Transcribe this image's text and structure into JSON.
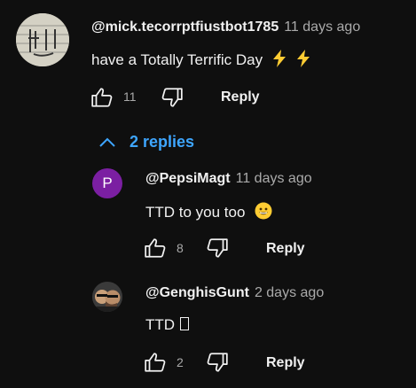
{
  "comment": {
    "author": "@mick.tecorrptfiustbot1785",
    "time": "11 days ago",
    "text": "have a Totally Terrific Day",
    "like_count": "11",
    "reply_label": "Reply"
  },
  "replies_toggle": {
    "label": "2 replies",
    "icon": "chevron-up-icon",
    "color": "#3ea6ff"
  },
  "replies": [
    {
      "author": "@PepsiMagt",
      "time": "11 days ago",
      "text": "TTD to you too",
      "avatar_letter": "P",
      "avatar_color": "#7b1fa2",
      "like_count": "8",
      "reply_label": "Reply"
    },
    {
      "author": "@GenghisGunt",
      "time": "2 days ago",
      "text": "TTD",
      "like_count": "2",
      "reply_label": "Reply"
    }
  ]
}
